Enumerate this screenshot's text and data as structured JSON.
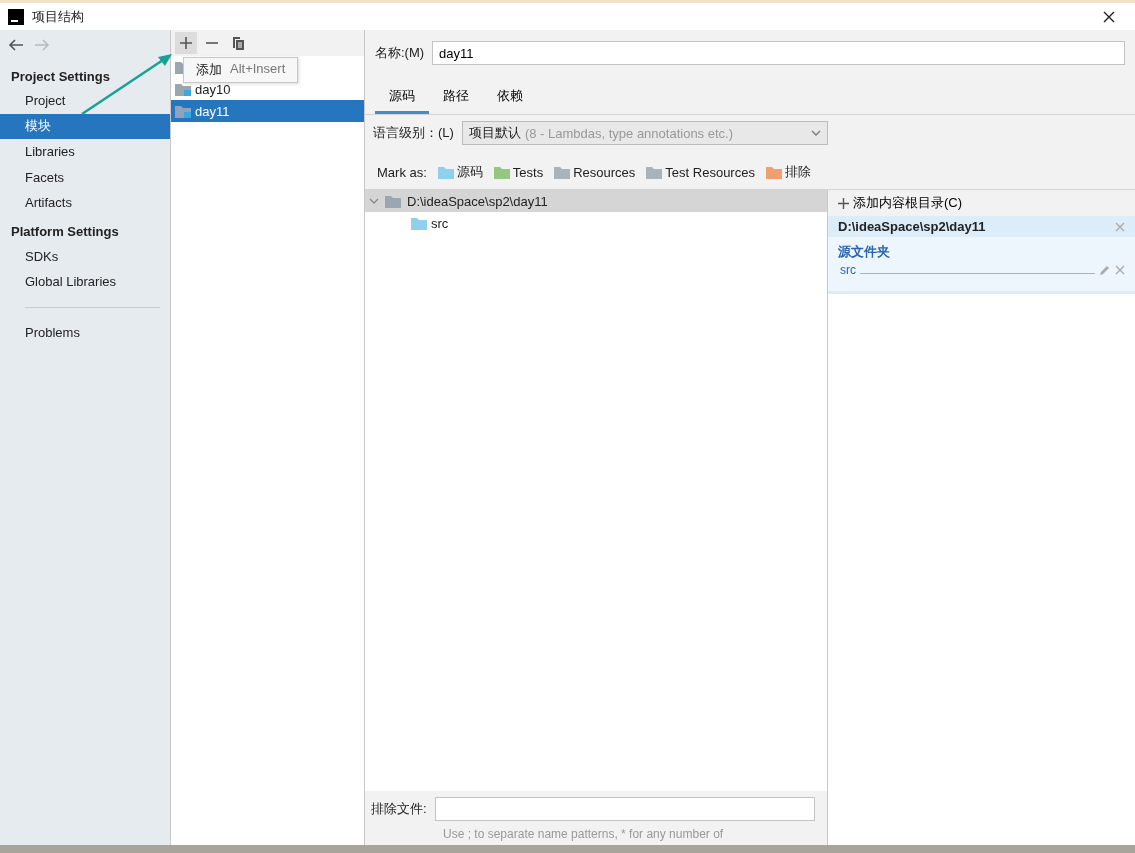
{
  "window": {
    "title": "项目结构"
  },
  "nav": {
    "back_enabled": true,
    "forward_enabled": false
  },
  "sidebar": {
    "sections": [
      {
        "heading": "Project Settings",
        "items": [
          {
            "label": "Project",
            "selected": false
          },
          {
            "label": "模块",
            "selected": true
          },
          {
            "label": "Libraries",
            "selected": false
          },
          {
            "label": "Facets",
            "selected": false
          },
          {
            "label": "Artifacts",
            "selected": false
          }
        ]
      },
      {
        "heading": "Platform Settings",
        "items": [
          {
            "label": "SDKs",
            "selected": false
          },
          {
            "label": "Global Libraries",
            "selected": false
          }
        ]
      }
    ],
    "footer_items": [
      {
        "label": "Problems",
        "selected": false
      }
    ]
  },
  "tooltip": {
    "label": "添加",
    "shortcut": "Alt+Insert"
  },
  "modules": [
    {
      "label": "day10",
      "selected": false
    },
    {
      "label": "day11",
      "selected": true
    }
  ],
  "name_field": {
    "label": "名称:(M)",
    "value": "day11"
  },
  "tabs": [
    {
      "label": "源码",
      "selected": true
    },
    {
      "label": "路径",
      "selected": false
    },
    {
      "label": "依赖",
      "selected": false
    }
  ],
  "language_level": {
    "label": "语言级别：(L)",
    "value": "项目默认",
    "hint": "(8 - Lambdas, type annotations etc.)"
  },
  "mark_as": {
    "label": "Mark as:",
    "items": [
      {
        "label": "源码",
        "color": "#8fd0ec"
      },
      {
        "label": "Tests",
        "color": "#96c77e"
      },
      {
        "label": "Resources",
        "color": "#aab2ba"
      },
      {
        "label": "Test Resources",
        "color": "#aab2ba"
      },
      {
        "label": "排除",
        "color": "#f0a070"
      }
    ]
  },
  "tree": {
    "root": {
      "label": "D:\\ideaSpace\\sp2\\day11",
      "expanded": true,
      "children": [
        {
          "label": "src"
        }
      ]
    }
  },
  "content_roots": {
    "add_label": "添加内容根目录(C)",
    "root": "D:\\ideaSpace\\sp2\\day11",
    "group": "源文件夹",
    "folders": [
      "src"
    ]
  },
  "exclude": {
    "label": "排除文件:",
    "hint": "Use ; to separate name patterns, * for any number of"
  }
}
